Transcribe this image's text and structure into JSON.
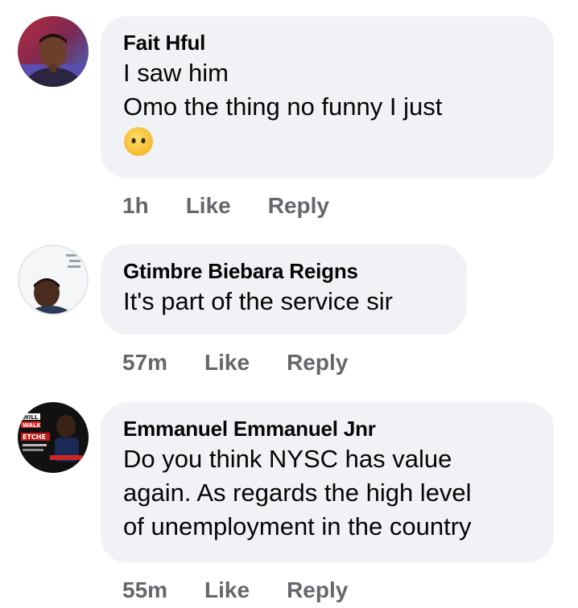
{
  "comments": [
    {
      "author": "Fait Hful",
      "lines": [
        "I saw him",
        "Omo the thing no funny I just"
      ],
      "emoji": "neutral-face-emoji",
      "time": "1h",
      "like_label": "Like",
      "reply_label": "Reply"
    },
    {
      "author": "Gtimbre Biebara Reigns",
      "lines": [
        "It's part of the service sir"
      ],
      "time": "57m",
      "like_label": "Like",
      "reply_label": "Reply"
    },
    {
      "author": "Emmanuel Emmanuel Jnr",
      "lines": [
        "Do you think NYSC has value",
        "again. As regards the high level",
        "of unemployment in the country"
      ],
      "avatar_text": [
        "WILL",
        "WALK",
        "ETCHE"
      ],
      "time": "55m",
      "like_label": "Like",
      "reply_label": "Reply"
    }
  ],
  "colors": {
    "bubble": "#f0f2f5",
    "meta": "#65676b",
    "text": "#050505"
  }
}
